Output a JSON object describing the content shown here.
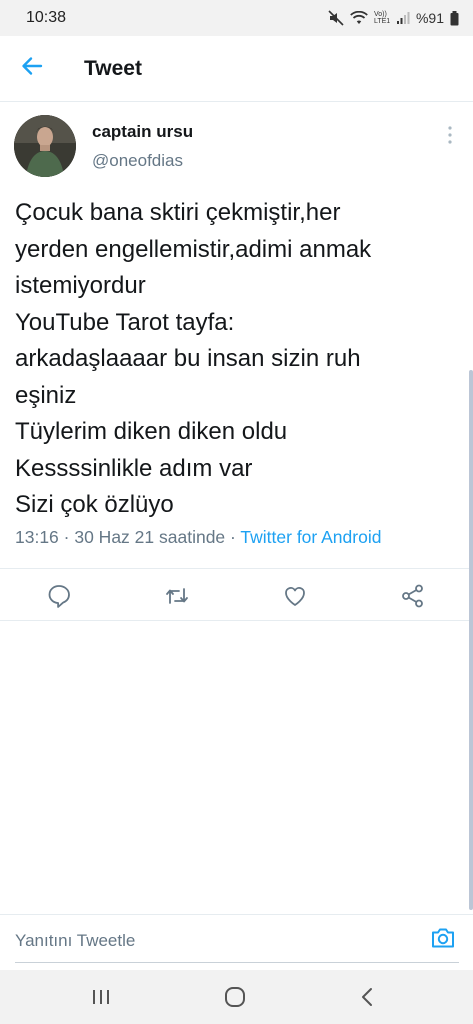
{
  "status_bar": {
    "time": "10:38",
    "network_label": "Vo)) LTE1",
    "battery_text": "%91",
    "icons": [
      "mute-icon",
      "wifi-icon",
      "signal-icon",
      "battery-icon"
    ]
  },
  "header": {
    "title": "Tweet",
    "back_icon": "arrow-left-icon"
  },
  "tweet": {
    "author": {
      "display_name": "captain ursu",
      "handle": "@oneofdias"
    },
    "text_lines": [
      "Çocuk bana sktiri çekmiştir,her",
      "yerden engellemistir,adimi anmak",
      "istemiyordur",
      "YouTube Tarot tayfa:",
      "arkadaşlaaaar bu insan sizin ruh",
      "eşiniz",
      "Tüylerim diken diken oldu",
      "Kessssinlikle adım var",
      "Sizi çok özlüyo"
    ],
    "meta": {
      "time": "13:16",
      "separator": " · ",
      "date": "30 Haz 21 saatinde",
      "source": "Twitter for Android"
    },
    "actions": [
      "reply-icon",
      "retweet-icon",
      "like-icon",
      "share-icon"
    ]
  },
  "reply_bar": {
    "placeholder": "Yanıtını Tweetle",
    "camera_icon": "camera-icon"
  },
  "nav_bar": {
    "buttons": [
      "recents-icon",
      "home-icon",
      "back-icon"
    ]
  },
  "colors": {
    "accent": "#1da1f2",
    "text_primary": "#14171a",
    "text_secondary": "#657786",
    "divider": "#e6ecf0"
  }
}
